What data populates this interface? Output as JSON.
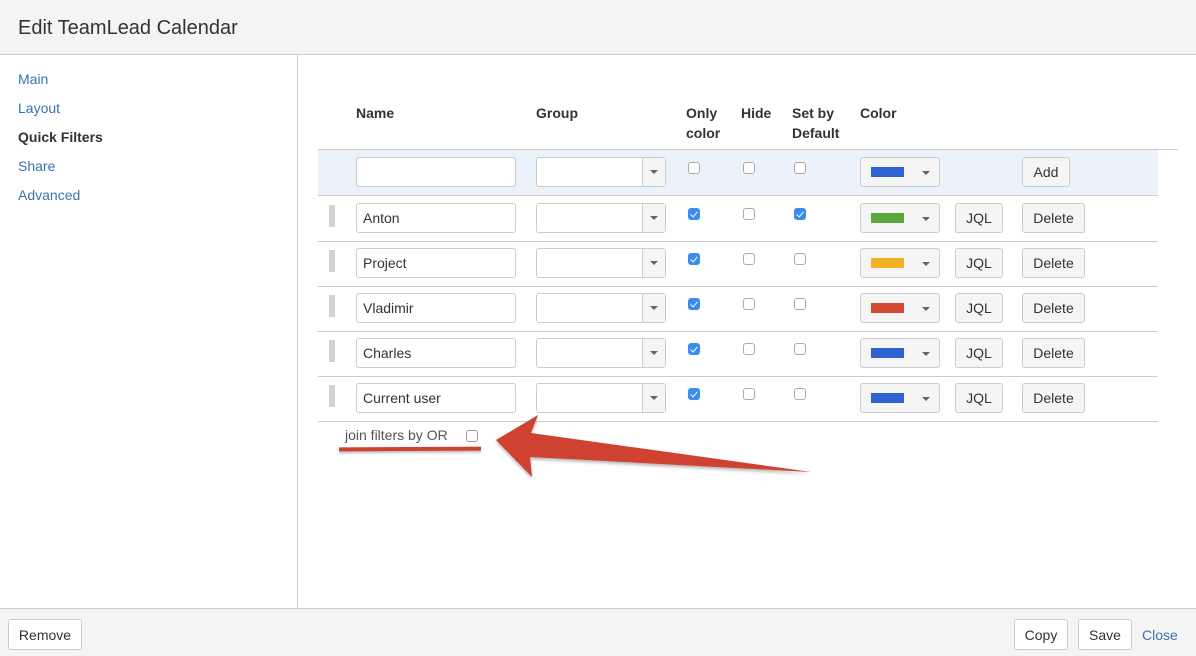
{
  "dialog": {
    "title": "Edit TeamLead Calendar"
  },
  "sidebar": {
    "items": [
      {
        "label": "Main",
        "active": false
      },
      {
        "label": "Layout",
        "active": false
      },
      {
        "label": "Quick Filters",
        "active": true
      },
      {
        "label": "Share",
        "active": false
      },
      {
        "label": "Advanced",
        "active": false
      }
    ]
  },
  "table": {
    "headers": {
      "name": "Name",
      "group": "Group",
      "only_color_1": "Only",
      "only_color_2": "color",
      "hide": "Hide",
      "set_default_1": "Set by",
      "set_default_2": "Default",
      "color": "Color"
    },
    "new_row": {
      "name_value": "",
      "group_value": "",
      "only_color": false,
      "hide": false,
      "set_default": false,
      "color": "#2f63cf",
      "add_label": "Add"
    },
    "rows": [
      {
        "name": "Anton",
        "group": "",
        "only_color": true,
        "hide": false,
        "set_default": true,
        "color": "#5aa83b"
      },
      {
        "name": "Project",
        "group": "",
        "only_color": true,
        "hide": false,
        "set_default": false,
        "color": "#f0b323"
      },
      {
        "name": "Vladimir",
        "group": "",
        "only_color": true,
        "hide": false,
        "set_default": false,
        "color": "#d24a32"
      },
      {
        "name": "Charles",
        "group": "",
        "only_color": true,
        "hide": false,
        "set_default": false,
        "color": "#2f63cf"
      },
      {
        "name": "Current user",
        "group": "",
        "only_color": true,
        "hide": false,
        "set_default": false,
        "color": "#2f63cf"
      }
    ],
    "jql_label": "JQL",
    "delete_label": "Delete"
  },
  "join": {
    "label": "join filters by OR",
    "checked": false
  },
  "annotation": {
    "color": "#cf4232"
  },
  "footer": {
    "remove_label": "Remove",
    "copy_label": "Copy",
    "save_label": "Save",
    "close_label": "Close"
  },
  "icons": {
    "drag": "drag-handle-icon",
    "dropdown": "chevron-down-icon",
    "check": "checkmark-icon"
  }
}
